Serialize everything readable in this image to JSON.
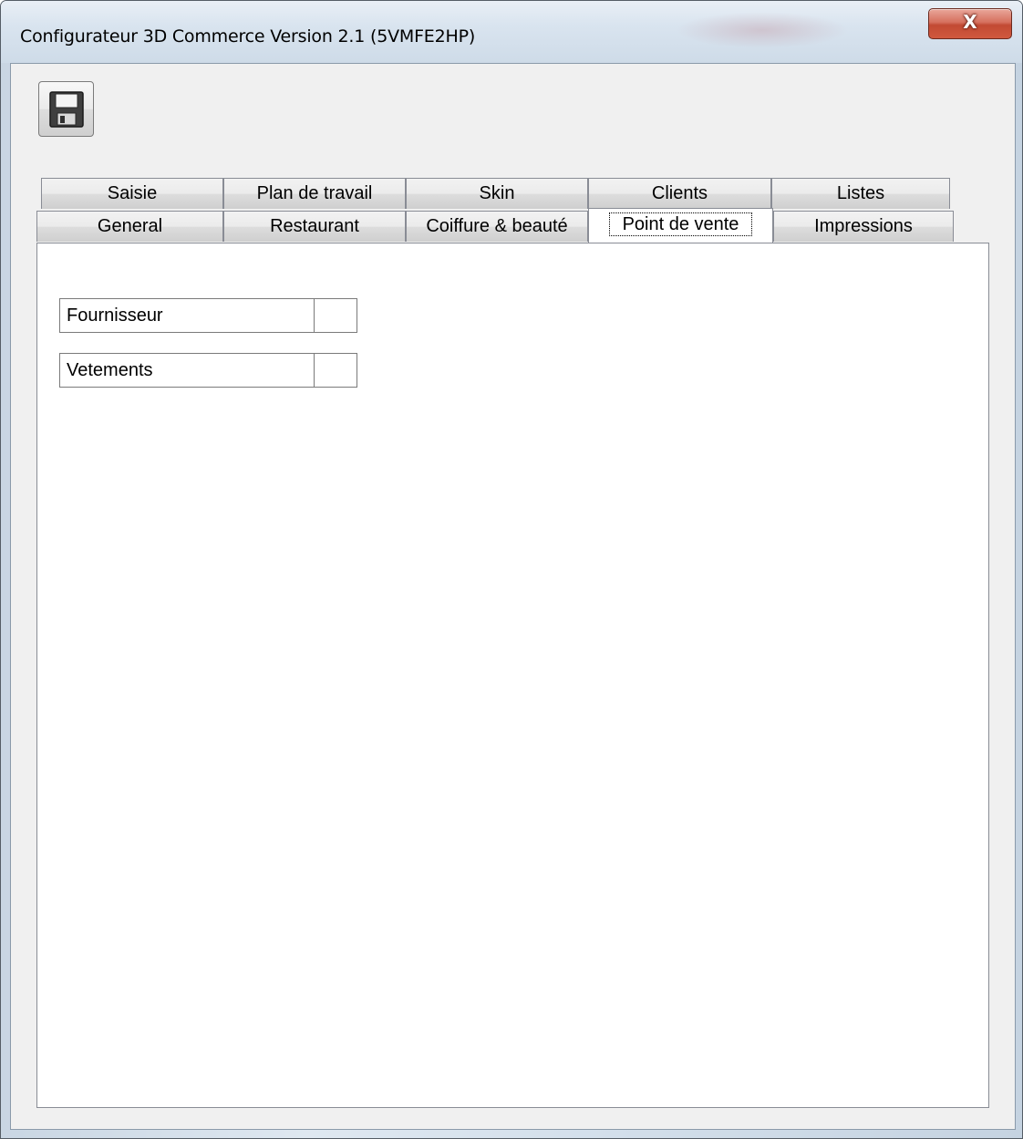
{
  "window": {
    "title": "Configurateur 3D Commerce Version 2.1 (5VMFE2HP)",
    "close_label": "X"
  },
  "toolbar": {
    "save_icon": "floppy-disk-icon"
  },
  "tabs": {
    "row_top": [
      {
        "label": "Saisie"
      },
      {
        "label": "Plan de travail"
      },
      {
        "label": "Skin"
      },
      {
        "label": "Clients"
      },
      {
        "label": "Listes"
      }
    ],
    "row_bottom": [
      {
        "label": "General"
      },
      {
        "label": "Restaurant"
      },
      {
        "label": "Coiffure & beauté"
      },
      {
        "label": "Point de vente",
        "selected": true
      },
      {
        "label": "Impressions"
      }
    ]
  },
  "point_de_vente": {
    "fields": [
      {
        "label": "Fournisseur",
        "checked": false
      },
      {
        "label": "Vetements",
        "checked": false
      }
    ]
  },
  "colors": {
    "close_button": "#c94a33",
    "window_frame": "#d3dfeb",
    "client_bg": "#f0f0f0",
    "tab_page_bg": "#ffffff"
  }
}
